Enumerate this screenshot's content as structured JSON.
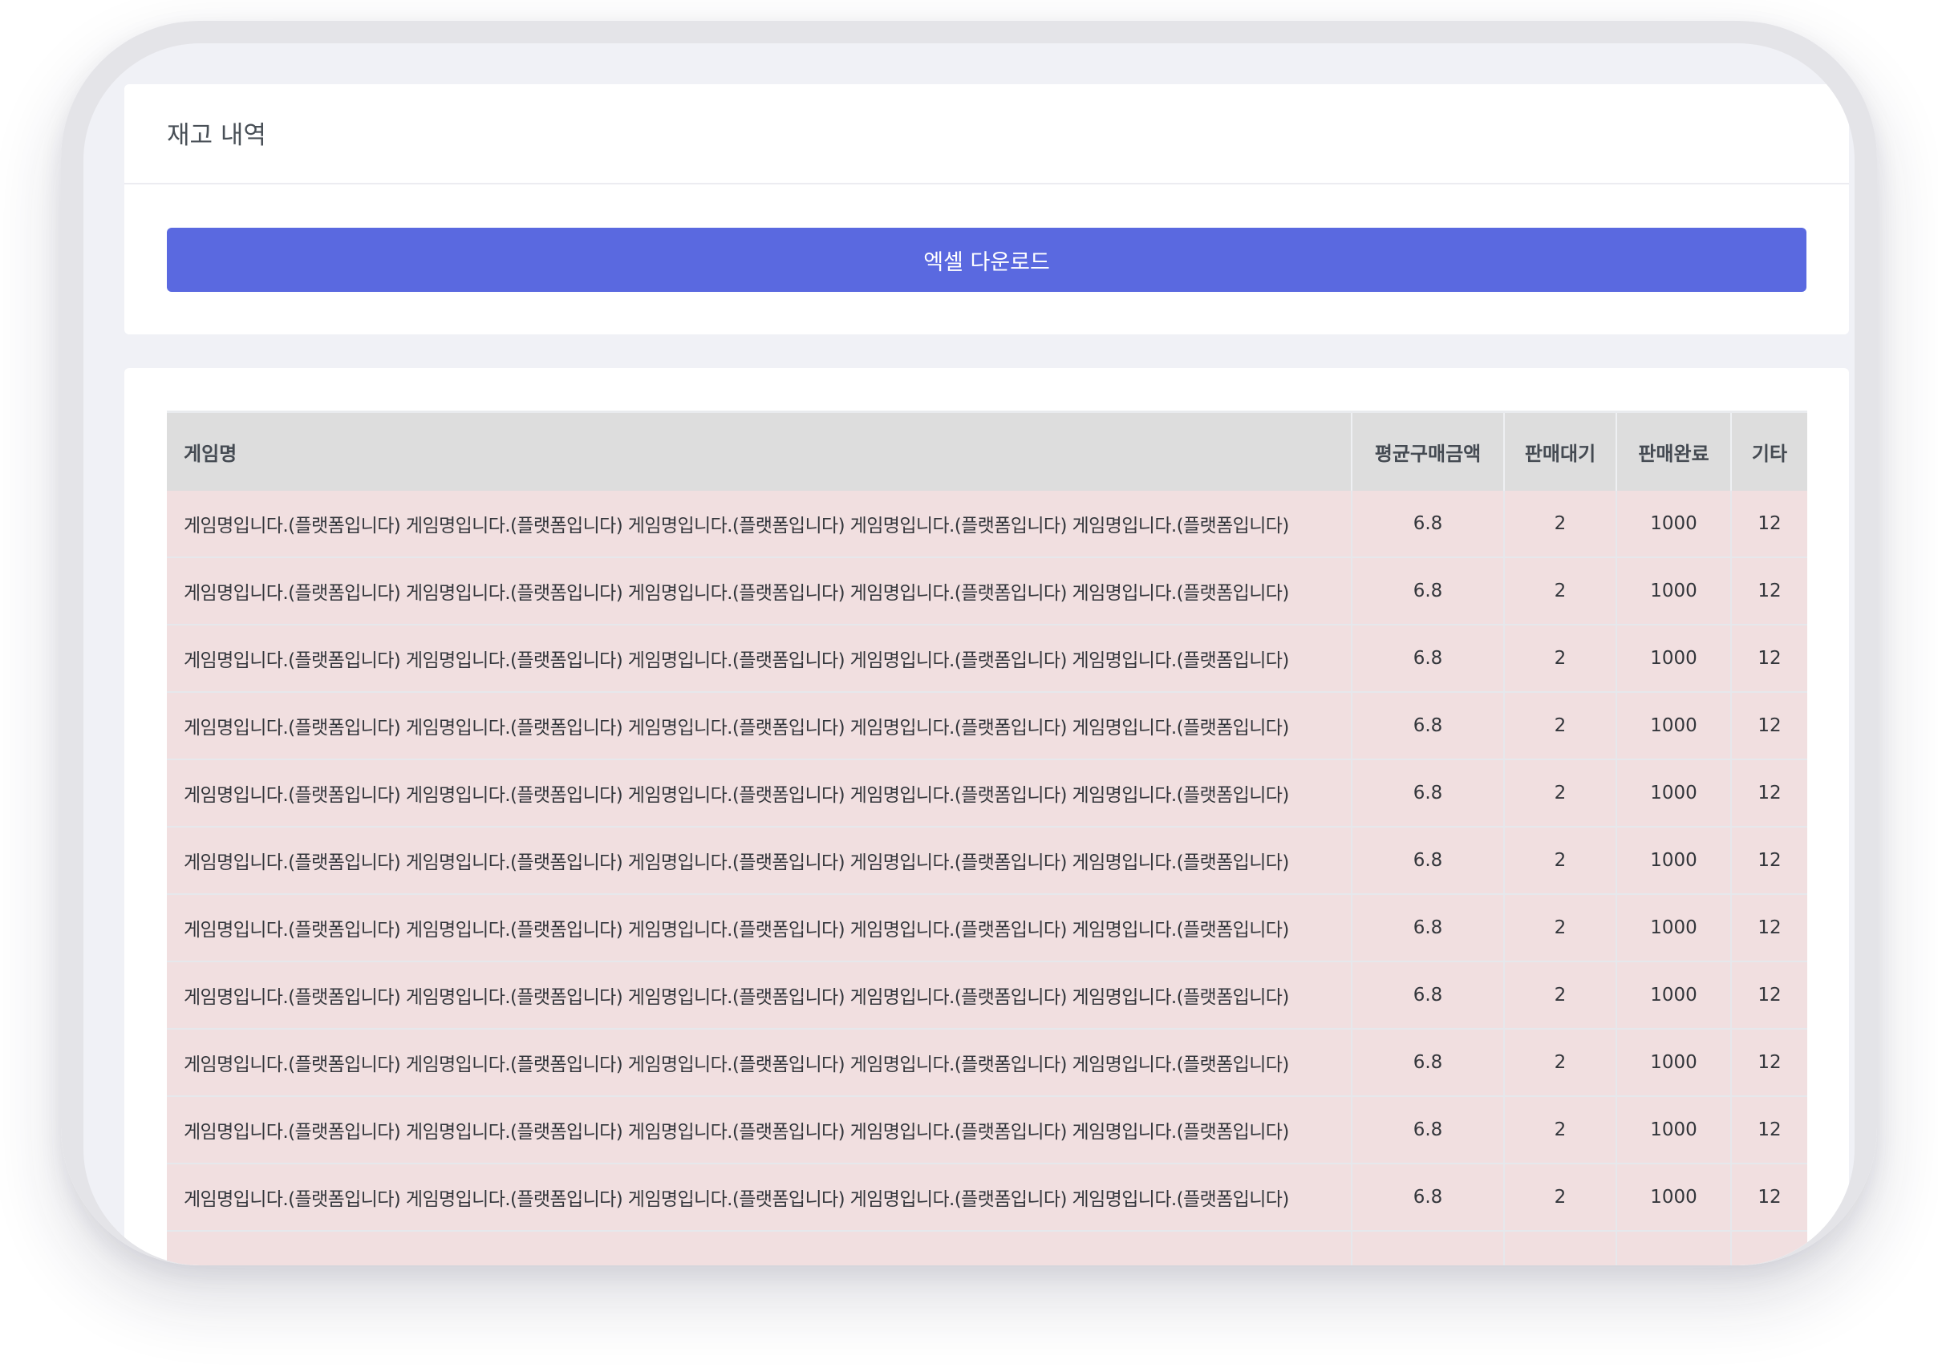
{
  "page": {
    "title": "재고 내역",
    "excel_button_label": "엑셀 다운로드"
  },
  "table": {
    "headers": [
      "게임명",
      "평균구매금액",
      "판매대기",
      "판매완료",
      "기타"
    ],
    "rows": [
      [
        "게임명입니다.(플랫폼입니다) 게임명입니다.(플랫폼입니다) 게임명입니다.(플랫폼입니다) 게임명입니다.(플랫폼입니다) 게임명입니다.(플랫폼입니다)",
        "6.8",
        "2",
        "1000",
        "12"
      ],
      [
        "게임명입니다.(플랫폼입니다) 게임명입니다.(플랫폼입니다) 게임명입니다.(플랫폼입니다) 게임명입니다.(플랫폼입니다) 게임명입니다.(플랫폼입니다)",
        "6.8",
        "2",
        "1000",
        "12"
      ],
      [
        "게임명입니다.(플랫폼입니다) 게임명입니다.(플랫폼입니다) 게임명입니다.(플랫폼입니다) 게임명입니다.(플랫폼입니다) 게임명입니다.(플랫폼입니다)",
        "6.8",
        "2",
        "1000",
        "12"
      ],
      [
        "게임명입니다.(플랫폼입니다) 게임명입니다.(플랫폼입니다) 게임명입니다.(플랫폼입니다) 게임명입니다.(플랫폼입니다) 게임명입니다.(플랫폼입니다)",
        "6.8",
        "2",
        "1000",
        "12"
      ],
      [
        "게임명입니다.(플랫폼입니다) 게임명입니다.(플랫폼입니다) 게임명입니다.(플랫폼입니다) 게임명입니다.(플랫폼입니다) 게임명입니다.(플랫폼입니다)",
        "6.8",
        "2",
        "1000",
        "12"
      ],
      [
        "게임명입니다.(플랫폼입니다) 게임명입니다.(플랫폼입니다) 게임명입니다.(플랫폼입니다) 게임명입니다.(플랫폼입니다) 게임명입니다.(플랫폼입니다)",
        "6.8",
        "2",
        "1000",
        "12"
      ],
      [
        "게임명입니다.(플랫폼입니다) 게임명입니다.(플랫폼입니다) 게임명입니다.(플랫폼입니다) 게임명입니다.(플랫폼입니다) 게임명입니다.(플랫폼입니다)",
        "6.8",
        "2",
        "1000",
        "12"
      ],
      [
        "게임명입니다.(플랫폼입니다) 게임명입니다.(플랫폼입니다) 게임명입니다.(플랫폼입니다) 게임명입니다.(플랫폼입니다) 게임명입니다.(플랫폼입니다)",
        "6.8",
        "2",
        "1000",
        "12"
      ],
      [
        "게임명입니다.(플랫폼입니다) 게임명입니다.(플랫폼입니다) 게임명입니다.(플랫폼입니다) 게임명입니다.(플랫폼입니다) 게임명입니다.(플랫폼입니다)",
        "6.8",
        "2",
        "1000",
        "12"
      ],
      [
        "게임명입니다.(플랫폼입니다) 게임명입니다.(플랫폼입니다) 게임명입니다.(플랫폼입니다) 게임명입니다.(플랫폼입니다) 게임명입니다.(플랫폼입니다)",
        "6.8",
        "2",
        "1000",
        "12"
      ],
      [
        "게임명입니다.(플랫폼입니다) 게임명입니다.(플랫폼입니다) 게임명입니다.(플랫폼입니다) 게임명입니다.(플랫폼입니다) 게임명입니다.(플랫폼입니다)",
        "6.8",
        "2",
        "1000",
        "12"
      ],
      [
        "",
        "",
        "",
        "",
        ""
      ]
    ]
  },
  "colors": {
    "accent": "#5a69e0",
    "row_highlight": "#f1dfe0",
    "header_bg": "#dddddd",
    "screen_bg": "#f0f1f6"
  }
}
